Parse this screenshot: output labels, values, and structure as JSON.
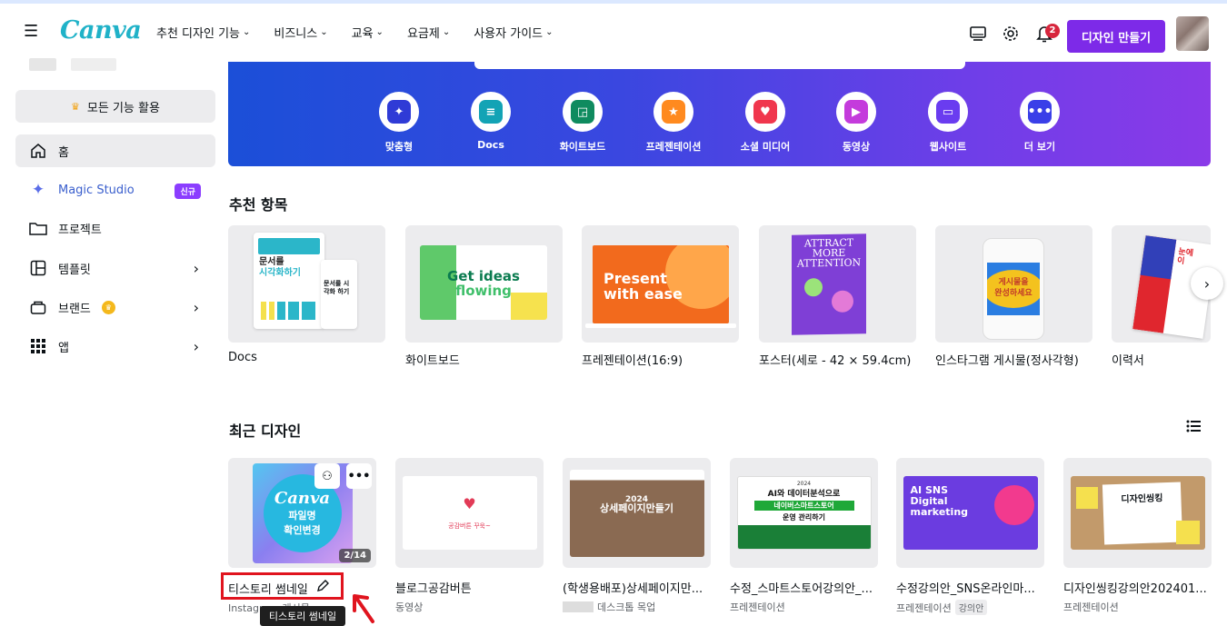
{
  "header": {
    "logo": "Canva",
    "nav": [
      "추천 디자인 기능",
      "비즈니스",
      "교육",
      "요금제",
      "사용자 가이드"
    ],
    "notification_count": "2",
    "create_button": "디자인 만들기"
  },
  "sidebar": {
    "all_features": "모든 기능 활용",
    "items": [
      {
        "label": "홈",
        "icon": "home-icon"
      },
      {
        "label": "Magic Studio",
        "icon": "sparkle-icon",
        "badge": "신규"
      },
      {
        "label": "프로젝트",
        "icon": "folder-icon"
      },
      {
        "label": "템플릿",
        "icon": "template-icon"
      },
      {
        "label": "브랜드",
        "icon": "brand-icon"
      },
      {
        "label": "앱",
        "icon": "apps-grid-icon"
      }
    ]
  },
  "categories": [
    {
      "label": "맞춤형",
      "icon": "sparkle-icon",
      "color": "#2f3bd6"
    },
    {
      "label": "Docs",
      "icon": "docs-icon",
      "color": "#13a3b5"
    },
    {
      "label": "화이트보드",
      "icon": "whiteboard-icon",
      "color": "#0f8b5f"
    },
    {
      "label": "프레젠테이션",
      "icon": "presentation-icon",
      "color": "#ff8a1f"
    },
    {
      "label": "소셜 미디어",
      "icon": "heart-icon",
      "color": "#f0364d"
    },
    {
      "label": "동영상",
      "icon": "video-icon",
      "color": "#c43bdc"
    },
    {
      "label": "웹사이트",
      "icon": "website-icon",
      "color": "#6a3cf0"
    },
    {
      "label": "더 보기",
      "icon": "more-icon",
      "color": "#3a3fe8"
    }
  ],
  "recommended": {
    "title": "추천 항목",
    "items": [
      {
        "label": "Docs",
        "thumb_text": [
          "문서를",
          "시각화하기",
          "문서를 시각화 하기"
        ]
      },
      {
        "label": "화이트보드",
        "thumb_text": [
          "Get ideas",
          "flowing"
        ]
      },
      {
        "label": "프레젠테이션(16:9)",
        "thumb_text": [
          "Present",
          "with ease"
        ]
      },
      {
        "label": "포스터(세로 - 42 × 59.4cm)",
        "thumb_text": [
          "ATTRACT",
          "MORE",
          "ATTENTION"
        ]
      },
      {
        "label": "인스타그램 게시물(정사각형)",
        "thumb_text": [
          "게시물을",
          "완성하세요"
        ]
      },
      {
        "label": "이력서",
        "thumb_text": [
          "눈에",
          "이"
        ]
      }
    ]
  },
  "recent": {
    "title": "최근 디자인",
    "items": [
      {
        "title": "티스토리 썸네일",
        "sub": "Instagram 게시물",
        "page_badge": "2/14",
        "thumb_text": [
          "Canva",
          "파일명",
          "확인변경"
        ]
      },
      {
        "title": "블로그공감버튼",
        "sub": "동영상",
        "thumb_text": [
          "공감버튼 꾸욱~"
        ]
      },
      {
        "title": "(학생용배포)상세페이지만...",
        "sub": "데스크톱 목업",
        "thumb_text": [
          "2024",
          "상세페이지만들기"
        ]
      },
      {
        "title": "수정_스마트스토어강의안_...",
        "sub": "프레젠테이션",
        "thumb_text": [
          "2024",
          "AI와 데이터분석으로",
          "네이버스마트스토어",
          "운영 관리하기"
        ]
      },
      {
        "title": "수정강의안_SNS온라인마...",
        "sub": "프레젠테이션",
        "tag": "강의안",
        "thumb_text": [
          "AI",
          "SNS",
          "Digital",
          "marketing"
        ]
      },
      {
        "title": "디자인씽킹강의안202401...",
        "sub": "프레젠테이션",
        "thumb_text": [
          "디자인씽킹"
        ]
      }
    ]
  },
  "tooltip": "티스토리 썸네일",
  "colors": {
    "accent": "#7d2ae8",
    "teal_logo": "#20b2c8",
    "highlight_red": "#e0141e"
  }
}
